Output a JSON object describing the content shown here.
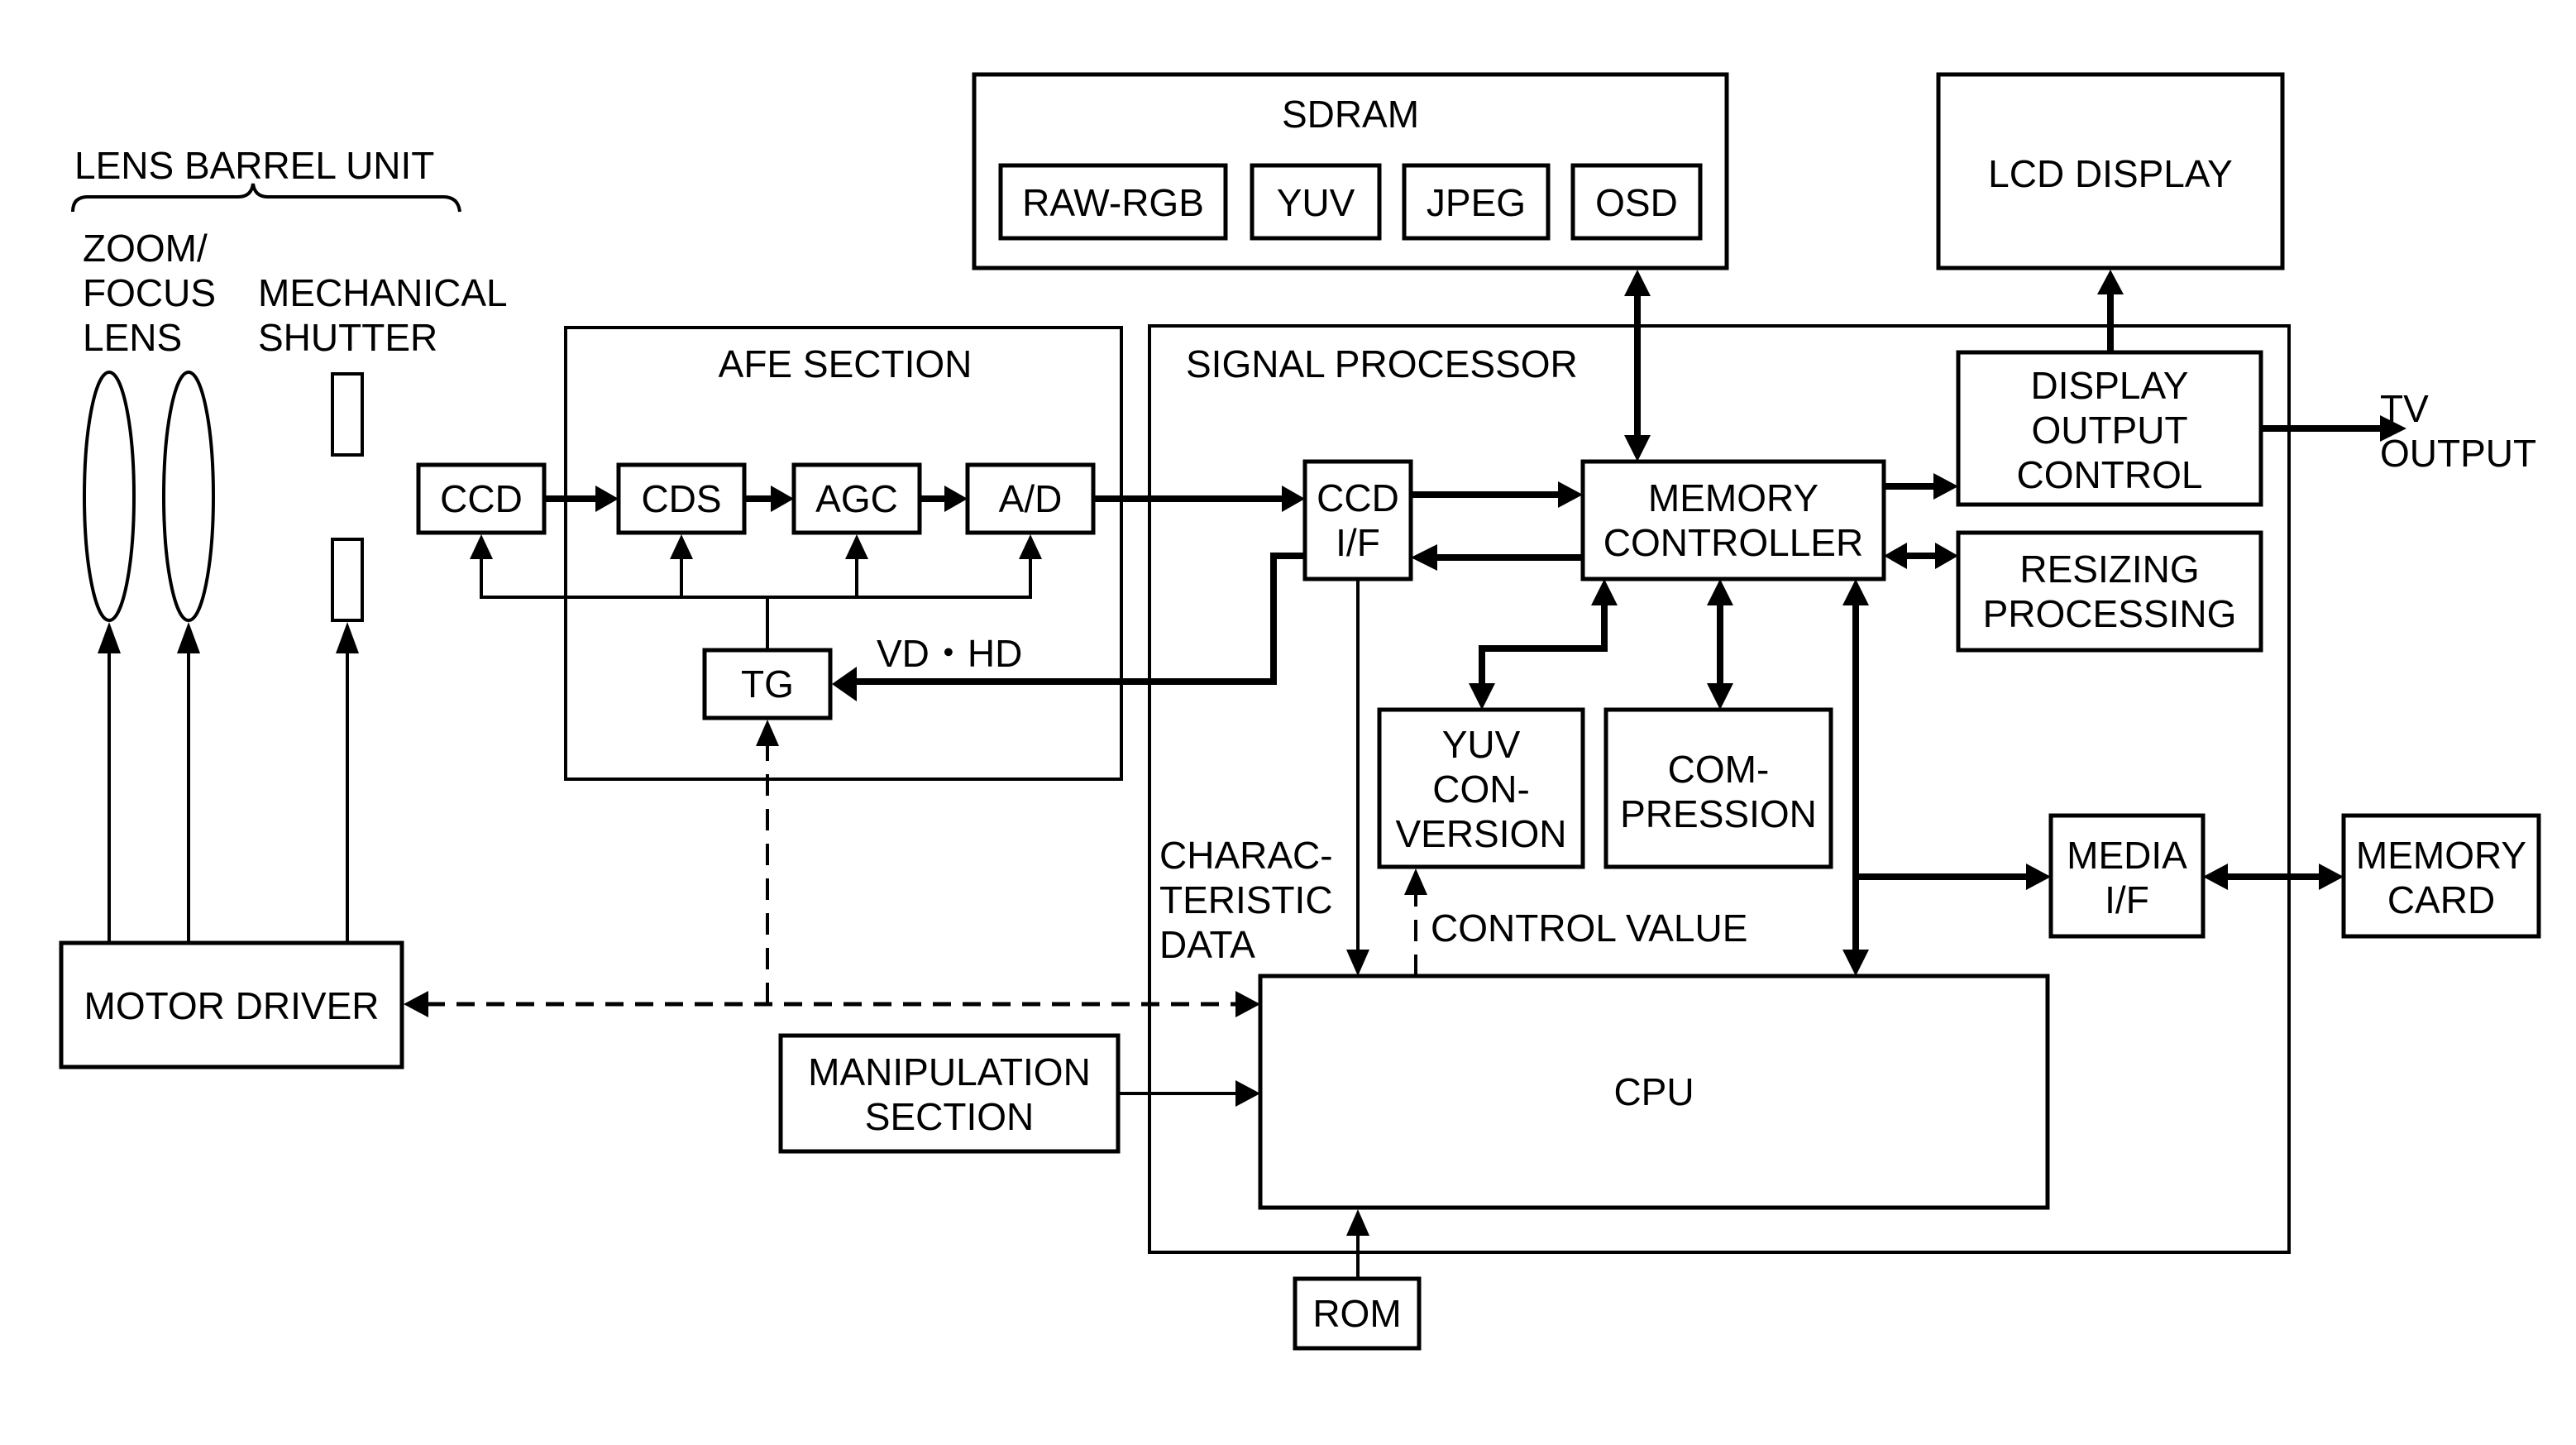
{
  "diagram": {
    "type": "block-diagram",
    "groups": {
      "lens_barrel_unit": "LENS BARREL UNIT",
      "afe_section": "AFE SECTION",
      "signal_processor": "SIGNAL PROCESSOR",
      "sdram": "SDRAM"
    },
    "lens_barrel": {
      "zoom_focus_lens": [
        "ZOOM/",
        "FOCUS",
        "LENS"
      ],
      "mechanical_shutter": [
        "MECHANICAL",
        "SHUTTER"
      ]
    },
    "blocks": {
      "ccd": "CCD",
      "cds": "CDS",
      "agc": "AGC",
      "ad": "A/D",
      "tg": "TG",
      "motor_driver": "MOTOR DRIVER",
      "ccd_if": [
        "CCD",
        "I/F"
      ],
      "memory_controller": [
        "MEMORY",
        "CONTROLLER"
      ],
      "display_output_control": [
        "DISPLAY",
        "OUTPUT",
        "CONTROL"
      ],
      "resizing_processing": [
        "RESIZING",
        "PROCESSING"
      ],
      "yuv_conversion": [
        "YUV",
        "CON-",
        "VERSION"
      ],
      "compression": [
        "COM-",
        "PRESSION"
      ],
      "cpu": "CPU",
      "manipulation_section": [
        "MANIPULATION",
        "SECTION"
      ],
      "rom": "ROM",
      "media_if": [
        "MEDIA",
        "I/F"
      ],
      "memory_card": [
        "MEMORY",
        "CARD"
      ],
      "lcd_display": "LCD DISPLAY"
    },
    "sdram_areas": [
      "RAW-RGB",
      "YUV",
      "JPEG",
      "OSD"
    ],
    "labels": {
      "vd_hd": "VD・HD",
      "tv_output": [
        "TV",
        "OUTPUT"
      ],
      "characteristic_data": [
        "CHARAC-",
        "TERISTIC",
        "DATA"
      ],
      "control_value": "CONTROL VALUE"
    },
    "connections": [
      {
        "from": "CCD",
        "to": "CDS",
        "style": "solid"
      },
      {
        "from": "CDS",
        "to": "AGC",
        "style": "solid"
      },
      {
        "from": "AGC",
        "to": "A/D",
        "style": "solid"
      },
      {
        "from": "A/D",
        "to": "CCD I/F",
        "style": "solid"
      },
      {
        "from": "TG",
        "to": [
          "CCD",
          "CDS",
          "AGC",
          "A/D"
        ],
        "style": "solid"
      },
      {
        "from": "CCD I/F",
        "to": "TG",
        "label": "VD・HD",
        "style": "solid"
      },
      {
        "from": "CCD I/F",
        "to": "MEMORY CONTROLLER",
        "style": "solid"
      },
      {
        "from": "MEMORY CONTROLLER",
        "to": "CCD I/F",
        "style": "solid"
      },
      {
        "between": [
          "SDRAM",
          "MEMORY CONTROLLER"
        ],
        "style": "bidirectional"
      },
      {
        "from": "MEMORY CONTROLLER",
        "to": "DISPLAY OUTPUT CONTROL",
        "style": "solid"
      },
      {
        "from": "DISPLAY OUTPUT CONTROL",
        "to": "LCD DISPLAY",
        "style": "solid"
      },
      {
        "from": "DISPLAY OUTPUT CONTROL",
        "to": "TV OUTPUT",
        "style": "solid"
      },
      {
        "between": [
          "MEMORY CONTROLLER",
          "RESIZING PROCESSING"
        ],
        "style": "bidirectional"
      },
      {
        "between": [
          "MEMORY CONTROLLER",
          "YUV CONVERSION"
        ],
        "style": "bidirectional"
      },
      {
        "between": [
          "MEMORY CONTROLLER",
          "COMPRESSION"
        ],
        "style": "bidirectional"
      },
      {
        "between": [
          "MEMORY CONTROLLER",
          "CPU"
        ],
        "style": "bidirectional"
      },
      {
        "from": "CPU bus",
        "to": "MEDIA I/F",
        "style": "solid"
      },
      {
        "between": [
          "MEDIA I/F",
          "MEMORY CARD"
        ],
        "style": "bidirectional"
      },
      {
        "from": "CCD I/F",
        "to": "CPU",
        "label": "CHARACTERISTIC DATA",
        "style": "solid"
      },
      {
        "from": "CPU",
        "to": "YUV CONVERSION",
        "label": "CONTROL VALUE",
        "style": "dashed"
      },
      {
        "between": [
          "MOTOR DRIVER",
          "CPU"
        ],
        "style": "dashed-bidirectional"
      },
      {
        "from": "CPU link",
        "to": "TG",
        "style": "dashed"
      },
      {
        "from": "MANIPULATION SECTION",
        "to": "CPU",
        "style": "solid"
      },
      {
        "from": "ROM",
        "to": "CPU",
        "style": "solid"
      },
      {
        "from": "MOTOR DRIVER",
        "to": [
          "ZOOM LENS",
          "FOCUS LENS",
          "MECHANICAL SHUTTER"
        ],
        "style": "solid"
      }
    ]
  }
}
